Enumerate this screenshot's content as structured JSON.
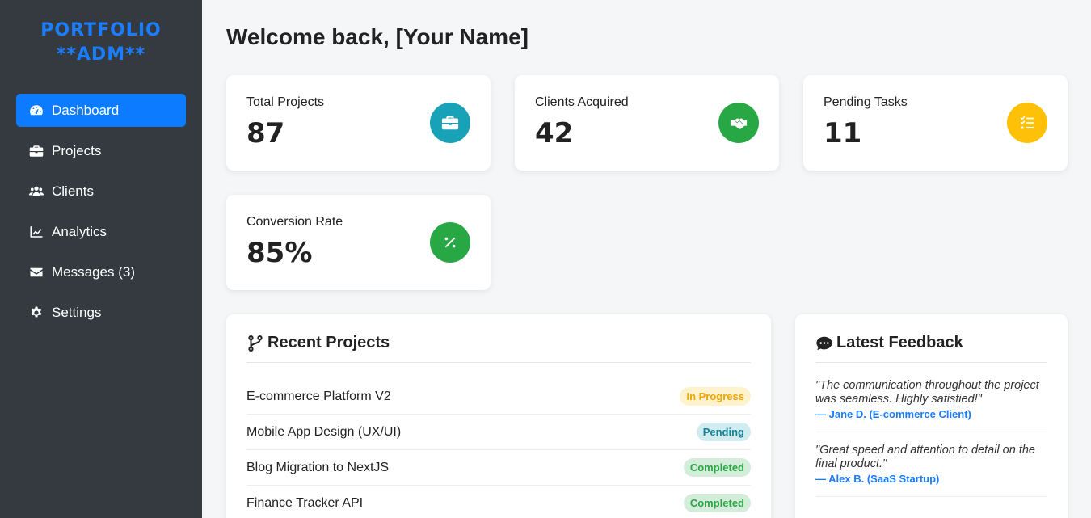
{
  "sidebar": {
    "logo_line1": "PORTFOLIO",
    "logo_line2": "**ADM**",
    "items": [
      {
        "label": "Dashboard",
        "icon": "gauge-icon",
        "active": true
      },
      {
        "label": "Projects",
        "icon": "briefcase-icon"
      },
      {
        "label": "Clients",
        "icon": "users-icon"
      },
      {
        "label": "Analytics",
        "icon": "chart-line-icon"
      },
      {
        "label": "Messages (3)",
        "icon": "envelope-icon"
      },
      {
        "label": "Settings",
        "icon": "gear-icon"
      }
    ],
    "colors": {
      "background": "#343a40",
      "active": "#0d7bff",
      "logo": "#1a7cff"
    }
  },
  "header": {
    "welcome": "Welcome back, [Your Name]"
  },
  "stats": [
    {
      "label": "Total Projects",
      "value": "87",
      "icon": "briefcase-icon",
      "color": "#17a2b8"
    },
    {
      "label": "Clients Acquired",
      "value": "42",
      "icon": "handshake-icon",
      "color": "#28a745"
    },
    {
      "label": "Pending Tasks",
      "value": "11",
      "icon": "task-list-icon",
      "color": "#ffc107"
    },
    {
      "label": "Conversion Rate",
      "value": "85%",
      "icon": "percent-icon",
      "color": "#28a745"
    }
  ],
  "recent_projects": {
    "title": "Recent Projects",
    "icon": "code-branch-icon",
    "rows": [
      {
        "name": "E-commerce Platform V2",
        "status": "In Progress"
      },
      {
        "name": "Mobile App Design (UX/UI)",
        "status": "Pending"
      },
      {
        "name": "Blog Migration to NextJS",
        "status": "Completed"
      },
      {
        "name": "Finance Tracker API",
        "status": "Completed"
      }
    ]
  },
  "feedback": {
    "title": "Latest Feedback",
    "icon": "comment-dots-icon",
    "items": [
      {
        "quote": "\"The communication throughout the project was seamless. Highly satisfied!\"",
        "author": "— Jane D. (E-commerce Client)"
      },
      {
        "quote": "\"Great speed and attention to detail on the final product.\"",
        "author": "— Alex B. (SaaS Startup)"
      }
    ]
  }
}
